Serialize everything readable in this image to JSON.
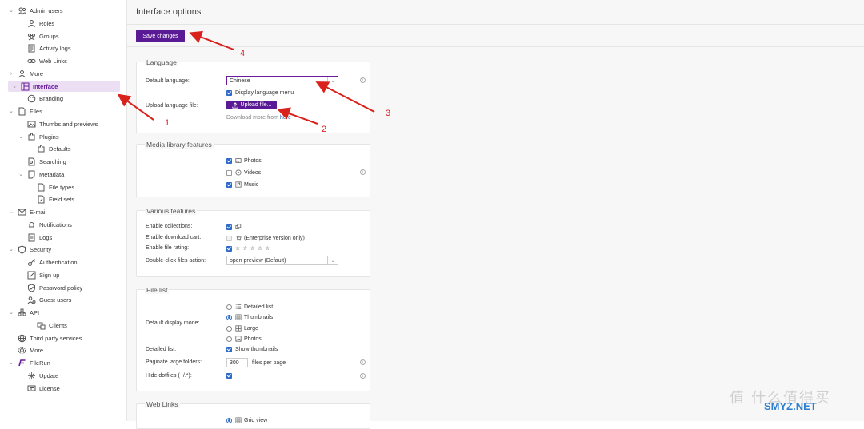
{
  "sidebar": {
    "items": [
      {
        "label": "Admin users",
        "icon": "users-icon",
        "chevron": "⌄"
      },
      {
        "label": "Roles",
        "icon": "role-icon"
      },
      {
        "label": "Groups",
        "icon": "groups-icon"
      },
      {
        "label": "Activity logs",
        "icon": "activity-log-icon"
      },
      {
        "label": "Web Links",
        "icon": "link-icon"
      },
      {
        "label": "More",
        "icon": "person-icon",
        "chevron": "›"
      },
      {
        "label": "Interface",
        "icon": "layout-icon",
        "chevron": "⌄",
        "active": true
      },
      {
        "label": "Branding",
        "icon": "palette-icon"
      },
      {
        "label": "Files",
        "icon": "file-icon",
        "chevron": "⌄"
      },
      {
        "label": "Thumbs and previews",
        "icon": "image-icon"
      },
      {
        "label": "Plugins",
        "icon": "puzzle-icon",
        "chevron": "⌄"
      },
      {
        "label": "Defaults",
        "icon": "puzzle-icon"
      },
      {
        "label": "Searching",
        "icon": "search-file-icon"
      },
      {
        "label": "Metadata",
        "icon": "metadata-icon",
        "chevron": "⌄"
      },
      {
        "label": "File types",
        "icon": "file-icon"
      },
      {
        "label": "Field sets",
        "icon": "edit-file-icon"
      },
      {
        "label": "E-mail",
        "icon": "mail-icon",
        "chevron": "⌄"
      },
      {
        "label": "Notifications",
        "icon": "bell-icon"
      },
      {
        "label": "Logs",
        "icon": "log-icon"
      },
      {
        "label": "Security",
        "icon": "shield-icon",
        "chevron": "⌄"
      },
      {
        "label": "Authentication",
        "icon": "key-icon"
      },
      {
        "label": "Sign up",
        "icon": "pencil-icon"
      },
      {
        "label": "Password policy",
        "icon": "shield-check-icon"
      },
      {
        "label": "Guest users",
        "icon": "guest-icon"
      },
      {
        "label": "API",
        "icon": "api-icon",
        "chevron": "⌄"
      },
      {
        "label": "Clients",
        "icon": "clients-icon"
      },
      {
        "label": "Third party services",
        "icon": "globe-icon"
      },
      {
        "label": "More",
        "icon": "gear-icon"
      },
      {
        "label": "FileRun",
        "icon": "filerun-logo-icon",
        "chevron": "⌄"
      },
      {
        "label": "Update",
        "icon": "sparkle-icon"
      },
      {
        "label": "License",
        "icon": "license-icon"
      }
    ]
  },
  "main": {
    "title": "Interface options",
    "save_label": "Save changes"
  },
  "language": {
    "title": "Language",
    "default_label": "Default language:",
    "default_value": "Chinese",
    "display_menu": "Display language menu",
    "upload_label": "Upload language file:",
    "upload_button": "Upload file...",
    "download_text": "Download more from",
    "download_link": "here"
  },
  "media": {
    "title": "Media library features",
    "options": [
      {
        "label": "Photos",
        "checked": true
      },
      {
        "label": "Videos",
        "checked": false
      },
      {
        "label": "Music",
        "checked": true
      }
    ]
  },
  "various": {
    "title": "Various features",
    "collections_label": "Enable collections:",
    "download_cart_label": "Enable download cart:",
    "download_cart_note": "(Enterprise version only)",
    "rating_label": "Enable file rating:",
    "dblclick_label": "Double-click files action:",
    "dblclick_value": "open preview (Default)"
  },
  "file_list": {
    "title": "File list",
    "display_mode_label": "Default display mode:",
    "modes": [
      {
        "label": "Detailed list",
        "selected": false
      },
      {
        "label": "Thumbnails",
        "selected": true
      },
      {
        "label": "Large",
        "selected": false
      },
      {
        "label": "Photos",
        "selected": false
      }
    ],
    "detailed_label": "Detailed list:",
    "show_thumbs": "Show thumbnails",
    "paginate_label": "Paginate large folders:",
    "paginate_value": "300",
    "paginate_suffix": "files per page",
    "dotfiles_label": "Hide dotfiles (~/.*):"
  },
  "web_links": {
    "title": "Web Links",
    "first_option": "Grid view"
  },
  "annotations": {
    "labels": [
      "1",
      "2",
      "3",
      "4"
    ],
    "color": "#d9221c"
  },
  "watermark": {
    "text": "值 什么值得买",
    "site": "SMYZ.NET"
  },
  "colors": {
    "accent": "#5b1a95",
    "active_bg": "#ecdff4",
    "checkbox": "#2e6bc6"
  }
}
